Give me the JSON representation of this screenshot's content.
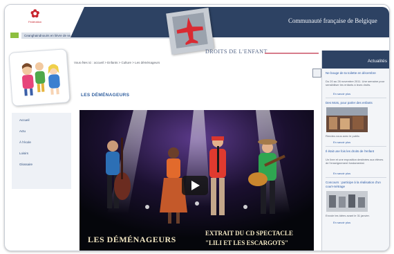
{
  "header": {
    "logo_text": "✿",
    "logo_sub": "Fédération",
    "strip_text": "Ceanghaindnouirs en lièvre de serviice",
    "community_title": "Communauté française de Belgique",
    "section_brand": "DROITS DE L'ENFANT"
  },
  "breadcrumb": "Vous êtes ici : accueil > Enfants > Culture > Les déménageurs",
  "page": {
    "section_title": "LES DÉMÉNAGEURS"
  },
  "nav": {
    "items": [
      "Accueil",
      "Actu",
      "À l'école",
      "Loisirs",
      "Glossaire"
    ]
  },
  "video": {
    "title_left": "LES DÉMÉNAGEURS",
    "title_right_1": "EXTRAIT DU CD SPECTACLE",
    "title_right_2": "\"LILI ET LES ESCARGOTS\""
  },
  "sidebar": {
    "heading": "Actualités",
    "items": [
      {
        "title": "Ne bouge de ta toilette en décembre",
        "text": "Du 20 au 26 novembre 2011. Une semaine pour sensibiliser les enfants à leurs droits.",
        "link": "En savoir plus"
      },
      {
        "title": "Des Mots, pour parler des enfants",
        "text": "Rendez-vous avec le public.",
        "link": "En savoir plus"
      },
      {
        "title": "Il était une fois les droits de l'enfant",
        "text": "Un livre et une exposition destinées aux élèves de l'enseignement fondamental.",
        "link": "En savoir plus"
      },
      {
        "title": "Concours : participe à la réalisation d'un court-métrage",
        "text": "Envoie tes idées avant le 31 janvier.",
        "link": "En savoir plus"
      }
    ]
  },
  "colors": {
    "navy": "#2d4263",
    "accent_blue": "#2f5e9e",
    "pink_rule": "#d77c8b",
    "logo_red": "#c8262f"
  },
  "icons": {
    "logo": "flower-logo-icon",
    "emblem": "airplane-emblem-icon",
    "print": "print-icon",
    "play": "play-icon"
  }
}
